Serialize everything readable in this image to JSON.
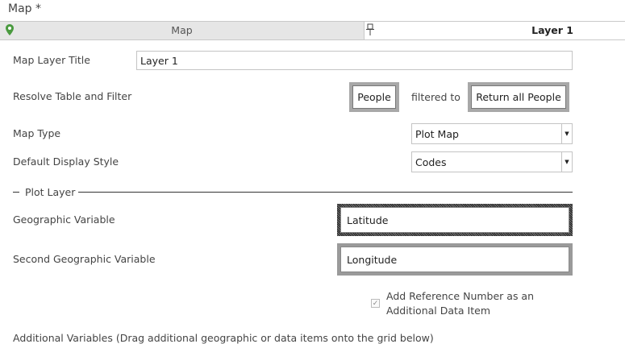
{
  "page": {
    "title": "Map *"
  },
  "tabs": {
    "map_label": "Map",
    "layer_label": "Layer 1"
  },
  "form": {
    "layer_title_label": "Map Layer Title",
    "layer_title_value": "Layer 1",
    "resolve_label": "Resolve Table and Filter",
    "resolve_table": "People",
    "filtered_to": "filtered to",
    "filter_value": "Return all People",
    "map_type_label": "Map Type",
    "map_type_value": "Plot Map",
    "display_style_label": "Default Display Style",
    "display_style_value": "Codes"
  },
  "plot_layer": {
    "section_title": "Plot Layer",
    "geo_var_label": "Geographic Variable",
    "geo_var_value": "Latitude",
    "second_geo_label": "Second Geographic Variable",
    "second_geo_value": "Longitude",
    "ref_checkbox_line1": "Add Reference Number as an",
    "ref_checkbox_line2": "Additional Data Item",
    "ref_checked": true,
    "additional_vars_label": "Additional Variables (Drag additional geographic or data items onto the grid below)"
  },
  "icons": {
    "map_tab_icon": "map-pin-icon",
    "layer_tab_icon": "push-pin-icon",
    "check_icon": "checkmark-icon",
    "dropdown_icon": "dropdown-arrow-icon"
  },
  "colors": {
    "pin_green": "#4a9a3f",
    "frame_gray": "#a8a8a8"
  }
}
